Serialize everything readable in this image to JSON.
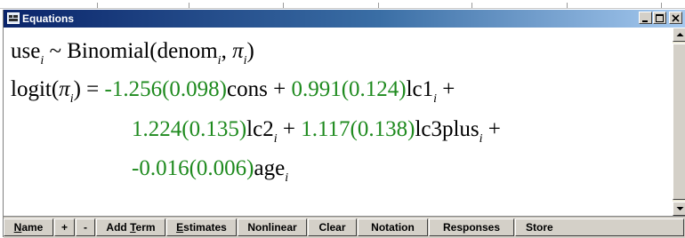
{
  "window": {
    "title": "Equations",
    "controls": [
      "minimize-icon",
      "maximize-icon",
      "close-icon"
    ]
  },
  "equation": {
    "line1": {
      "lhs": "use",
      "lhs_sub": "i",
      "tilde": " ~ ",
      "dist": "Binomial(denom",
      "dist_sub": "i",
      "sep": ", ",
      "pi": "π",
      "pi_sub": "i",
      "close": ")"
    },
    "line2": {
      "lhs": "logit(",
      "pi": "π",
      "pi_sub": "i",
      "eq": ") = ",
      "coef1": "-1.256(0.098)",
      "term1": "cons + ",
      "coef2": "0.991(0.124)",
      "term2": "lc1",
      "term2_sub": "i",
      "plus": " +"
    },
    "line3": {
      "coef3": "1.224(0.135)",
      "term3": "lc2",
      "term3_sub": "i",
      "mid": " + ",
      "coef4": "1.117(0.138)",
      "term4": "lc3plus",
      "term4_sub": "i",
      "plus": " +"
    },
    "line4": {
      "coef5": "-0.016(0.006)",
      "term5": "age",
      "term5_sub": "i"
    }
  },
  "toolbar": {
    "name": {
      "pre": "",
      "u": "N",
      "post": "ame"
    },
    "plus": "+",
    "minus": "-",
    "add_term": {
      "pre": "Add ",
      "u": "T",
      "post": "erm"
    },
    "estimates": {
      "pre": "",
      "u": "E",
      "post": "stimates"
    },
    "nonlinear": "Nonlinear",
    "clear": "Clear",
    "notation": "Notation",
    "responses": "Responses",
    "store": "Store"
  },
  "colors": {
    "coefficient": "#1e8a1e",
    "title_bar": "#0a246a"
  }
}
